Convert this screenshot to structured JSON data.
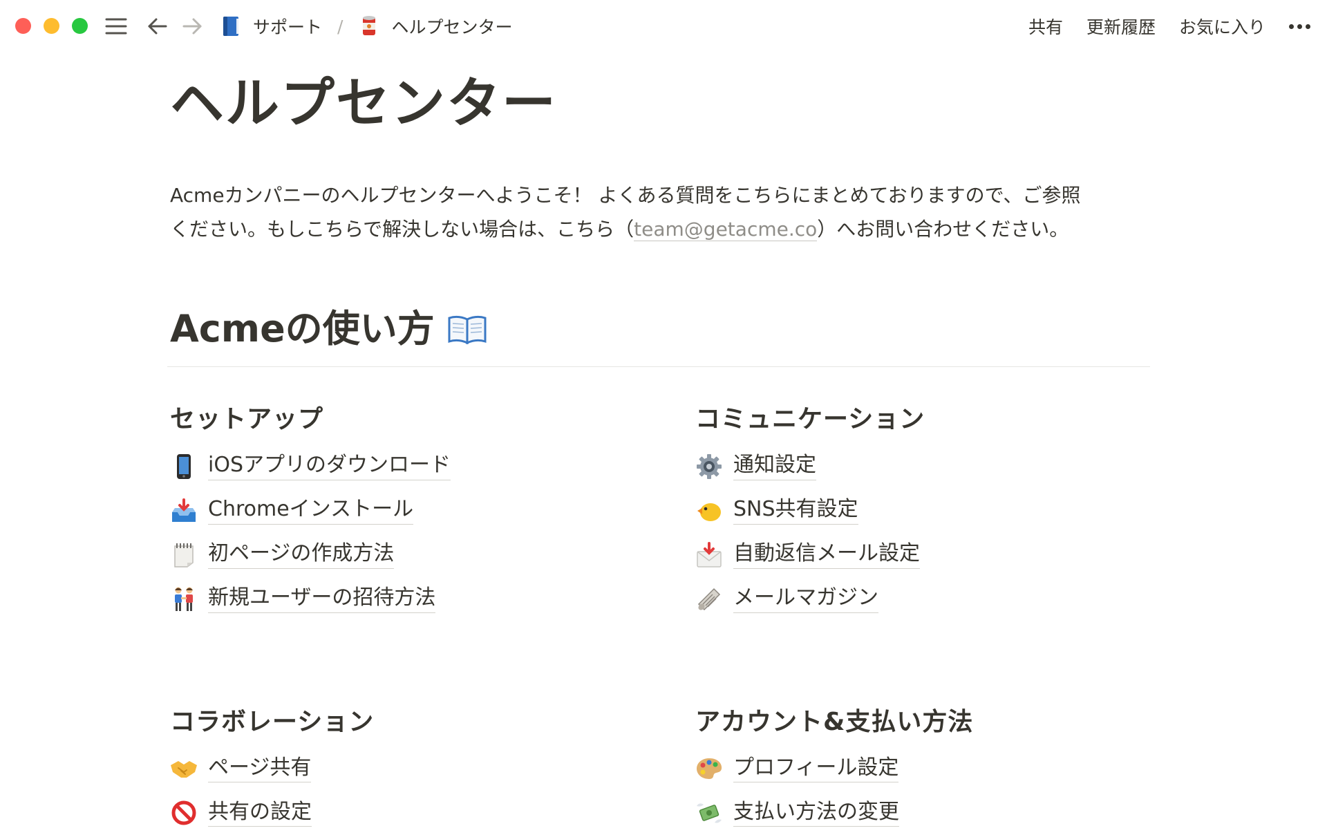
{
  "topbar": {
    "breadcrumbs": [
      {
        "label": "サポート",
        "icon": "blue-book-icon"
      },
      {
        "label": "ヘルプセンター",
        "icon": "canned-food-icon"
      }
    ],
    "separator": "/",
    "actions": {
      "share": "共有",
      "history": "更新履歴",
      "favorite": "お気に入り"
    }
  },
  "page": {
    "title": "ヘルプセンター",
    "intro_line1": "Acmeカンパニーのヘルプセンターへようこそ！ よくある質問をこちらにまとめておりますので、ご参照",
    "intro_line2_before": "ください。もしこちらで解決しない場合は、こちら（",
    "intro_link": "team@getacme.co",
    "intro_line2_after": "）へお問い合わせください。"
  },
  "section": {
    "title": "Acmeの使い方",
    "icon": "open-book-icon"
  },
  "groups": [
    {
      "title": "セットアップ",
      "items": [
        {
          "label": "iOSアプリのダウンロード",
          "icon": "mobile-phone-icon"
        },
        {
          "label": "Chromeインストール",
          "icon": "inbox-tray-icon"
        },
        {
          "label": "初ページの作成方法",
          "icon": "spiral-notepad-icon"
        },
        {
          "label": "新規ユーザーの招待方法",
          "icon": "people-holding-hands-icon"
        }
      ]
    },
    {
      "title": "コミュニケーション",
      "items": [
        {
          "label": "通知設定",
          "icon": "gear-icon"
        },
        {
          "label": "SNS共有設定",
          "icon": "chick-icon"
        },
        {
          "label": "自動返信メール設定",
          "icon": "envelope-arrow-icon"
        },
        {
          "label": "メールマガジン",
          "icon": "rolled-newspaper-icon"
        }
      ]
    },
    {
      "title": "コラボレーション",
      "items": [
        {
          "label": "ページ共有",
          "icon": "handshake-icon"
        },
        {
          "label": "共有の設定",
          "icon": "prohibited-icon"
        }
      ]
    },
    {
      "title": "アカウント&支払い方法",
      "items": [
        {
          "label": "プロフィール設定",
          "icon": "artist-palette-icon"
        },
        {
          "label": "支払い方法の変更",
          "icon": "money-with-wings-icon"
        }
      ]
    }
  ]
}
